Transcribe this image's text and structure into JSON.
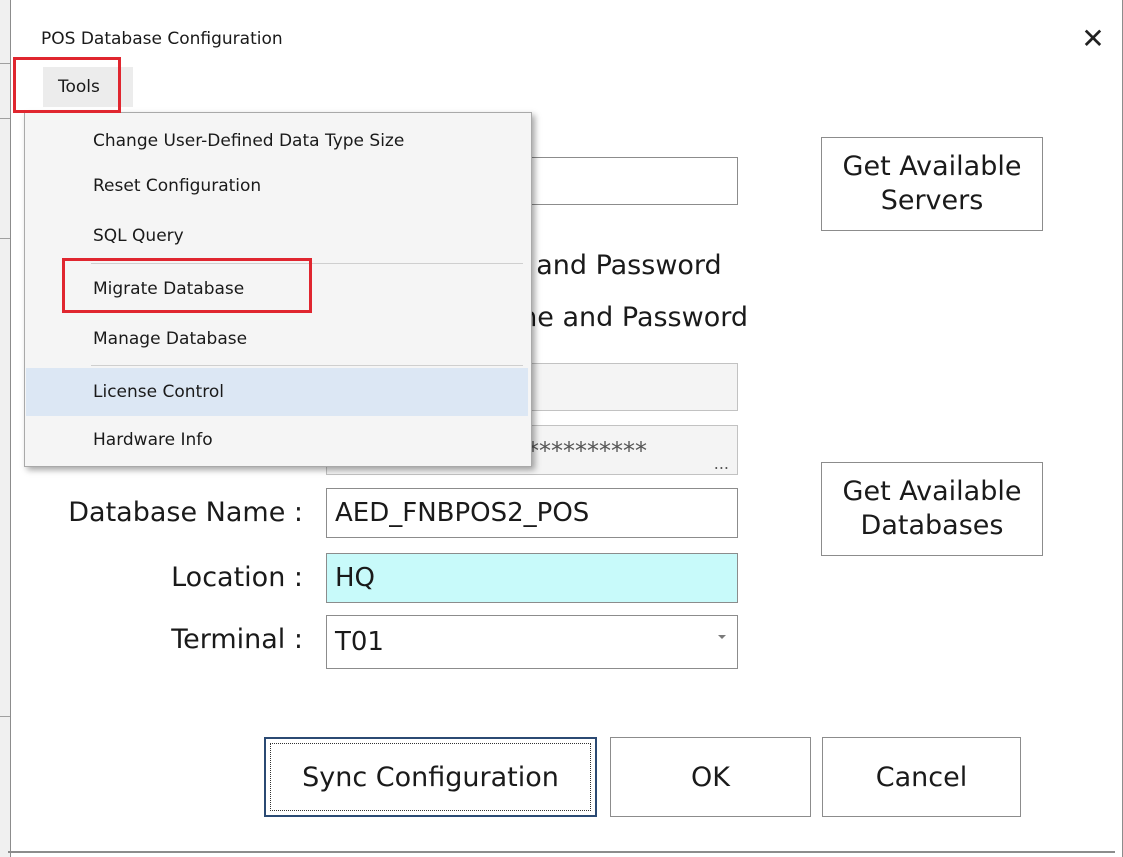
{
  "dialog": {
    "title": "POS Database Configuration",
    "close_glyph": "✕"
  },
  "menubar": {
    "tools": "Tools"
  },
  "tools_menu": {
    "items": [
      "Change User-Defined Data Type Size",
      "Reset Configuration",
      "SQL Query",
      "Migrate Database",
      "Manage Database",
      "License Control",
      "Hardware Info"
    ],
    "hovered_item": "License Control",
    "highlighted_item": "Migrate Database"
  },
  "form": {
    "server_value": "",
    "get_servers_line1": "Get Available",
    "get_servers_line2": "Servers",
    "auth_option1_tail": "e and Password",
    "auth_option2_tail": "me and Password",
    "user_value": "",
    "password_value": "**********",
    "password_ellipsis": "...",
    "database_label": "Database Name :",
    "database_value": "AED_FNBPOS2_POS",
    "get_databases_line1": "Get Available",
    "get_databases_line2": "Databases",
    "location_label": "Location :",
    "location_value": "HQ",
    "terminal_label": "Terminal :",
    "terminal_value": "T01"
  },
  "buttons": {
    "sync": "Sync Configuration",
    "ok": "OK",
    "cancel": "Cancel"
  },
  "colors": {
    "highlight_red": "#e0262f",
    "location_bg": "#c8fafa",
    "menu_hover": "#dce7f4"
  }
}
